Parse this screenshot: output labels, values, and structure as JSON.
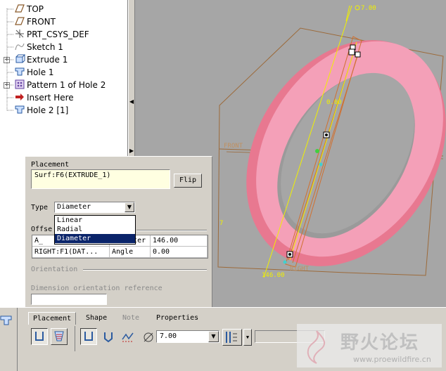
{
  "model_tree": {
    "items": [
      {
        "label": "TOP",
        "icon": "datum-plane-icon"
      },
      {
        "label": "FRONT",
        "icon": "datum-plane-icon"
      },
      {
        "label": "PRT_CSYS_DEF",
        "icon": "csys-icon"
      },
      {
        "label": "Sketch 1",
        "icon": "sketch-icon"
      },
      {
        "label": "Extrude 1",
        "icon": "extrude-icon"
      },
      {
        "label": "Hole 1",
        "icon": "hole-icon"
      },
      {
        "label": "Pattern 1 of Hole 2",
        "icon": "pattern-icon"
      },
      {
        "label": "Insert Here",
        "icon": "insert-arrow-icon"
      },
      {
        "label": "Hole 2 [1]",
        "icon": "hole-icon"
      }
    ]
  },
  "viewport": {
    "labels": {
      "top_dim": "7.00",
      "mid_dim": "0.00",
      "front": "FRONT",
      "right": "RIGHT",
      "bottom_dim": "146.00",
      "left_dim": "7"
    },
    "colors": {
      "ring": "#f090a8",
      "datum": "#b07a40",
      "dim": "#f0f000"
    }
  },
  "placement_panel": {
    "placement_label": "Placement",
    "placement_ref": "Surf:F6(EXTRUDE_1)",
    "flip_label": "Flip",
    "type_label": "Type",
    "type_value": "Diameter",
    "type_options": [
      "Linear",
      "Radial",
      "Diameter"
    ],
    "offset_label": "Offse",
    "offset_rows": [
      [
        "A_",
        "Diameter",
        "146.00"
      ],
      [
        "RIGHT:F1(DAT...",
        "Angle",
        "0.00"
      ]
    ],
    "orientation_label": "Orientation",
    "dim_orient_label": "Dimension orientation reference"
  },
  "dashboard": {
    "tabs": [
      "Placement",
      "Shape",
      "Note",
      "Properties"
    ],
    "depth_value": "7.00"
  },
  "watermark": {
    "title": "野火论坛",
    "url": "www.proewildfire.cn"
  }
}
